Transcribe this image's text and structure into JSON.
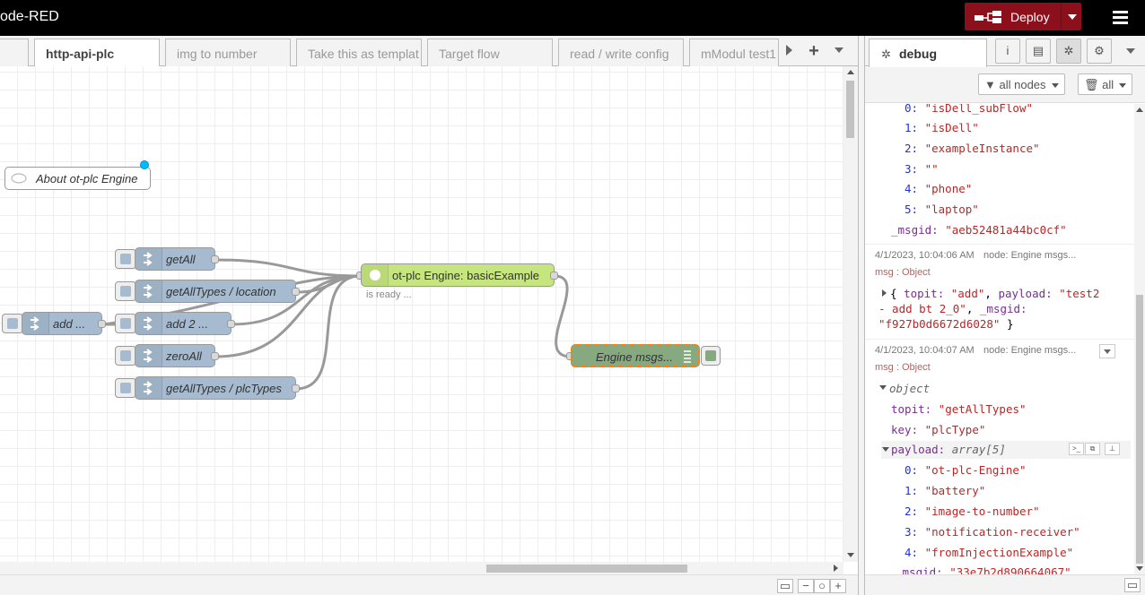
{
  "app": {
    "title": "ode-RED"
  },
  "header": {
    "deploy_label": "Deploy"
  },
  "tabs": [
    {
      "label": ""
    },
    {
      "label": "http-api-plc"
    },
    {
      "label": "img to number"
    },
    {
      "label": "Take this as templat"
    },
    {
      "label": "Target flow"
    },
    {
      "label": "read / write config"
    },
    {
      "label": "mModul test1"
    }
  ],
  "tab_add_label": "+",
  "nodes": {
    "comment": "About ot-plc Engine",
    "inject_getall": "getAll",
    "inject_getalltypes_location": "getAllTypes / location",
    "inject_add": "add ...",
    "inject_add2": "add 2 ...",
    "inject_zeroall": "zeroAll",
    "inject_getalltypes_plctypes": "getAllTypes / plcTypes",
    "engine": "ot-plc Engine: basicExample",
    "engine_status": "is ready ...",
    "debug": "Engine msgs..."
  },
  "sidebar": {
    "tab_label": "debug",
    "filter_nodes": "all nodes",
    "filter_clear": "all",
    "msg1_lines": [
      {
        "idx": "0:",
        "val": "\"isDell_subFlow\""
      },
      {
        "idx": "1:",
        "val": "\"isDell\""
      },
      {
        "idx": "2:",
        "val": "\"exampleInstance\""
      },
      {
        "idx": "3:",
        "val": "\"\""
      },
      {
        "idx": "4:",
        "val": "\"phone\""
      },
      {
        "idx": "5:",
        "val": "\"laptop\""
      }
    ],
    "msg1_msgid_key": "_msgid:",
    "msg1_msgid_val": "\"aeb52481a44bc0cf\"",
    "msg2_time": "4/1/2023, 10:04:06 AM",
    "msg2_node": "node: Engine msgs...",
    "msg2_type": "msg : Object",
    "msg2_l1a": "{ ",
    "msg2_topit_key": "topit:",
    "msg2_topit_val": "\"add\"",
    "msg2_payload_key": "payload:",
    "msg2_payload_val": "\"test2",
    "msg2_l2": "- add bt 2_0\"",
    "msg2_msgid_key": "_msgid:",
    "msg2_msgid_val": "\"f927b0d6672d6028\"",
    "msg2_close": "}",
    "msg3_time": "4/1/2023, 10:04:07 AM",
    "msg3_node": "node: Engine msgs...",
    "msg3_type": "msg : Object",
    "msg3_object": "object",
    "msg3_topit_key": "topit:",
    "msg3_topit_val": "\"getAllTypes\"",
    "msg3_key_key": "key:",
    "msg3_key_val": "\"plcType\"",
    "msg3_payload_key": "payload:",
    "msg3_payload_type": "array[5]",
    "msg3_items": [
      {
        "idx": "0:",
        "val": "\"ot-plc-Engine\""
      },
      {
        "idx": "1:",
        "val": "\"battery\""
      },
      {
        "idx": "2:",
        "val": "\"image-to-number\""
      },
      {
        "idx": "3:",
        "val": "\"notification-receiver\""
      },
      {
        "idx": "4:",
        "val": "\"fromInjectionExample\""
      }
    ],
    "msg3_msgid_key": "_msgid:",
    "msg3_msgid_val": "\"33e7b2d890664067\""
  },
  "colors": {
    "header_bg": "#000000",
    "deploy_bg": "#8c101c",
    "inject_node": "#a6bbcf",
    "engine_node": "#c7e57f",
    "debug_node": "#87a980",
    "selection": "#ff7f0e",
    "changed_dot": "#00bcff"
  },
  "icons": [
    "deploy-icon",
    "menu-icon",
    "bug-icon",
    "info-icon",
    "book-icon",
    "gear-icon",
    "filter-icon",
    "trash-icon",
    "map-icon",
    "zoom-out-icon",
    "zoom-reset-icon",
    "zoom-in-icon"
  ]
}
